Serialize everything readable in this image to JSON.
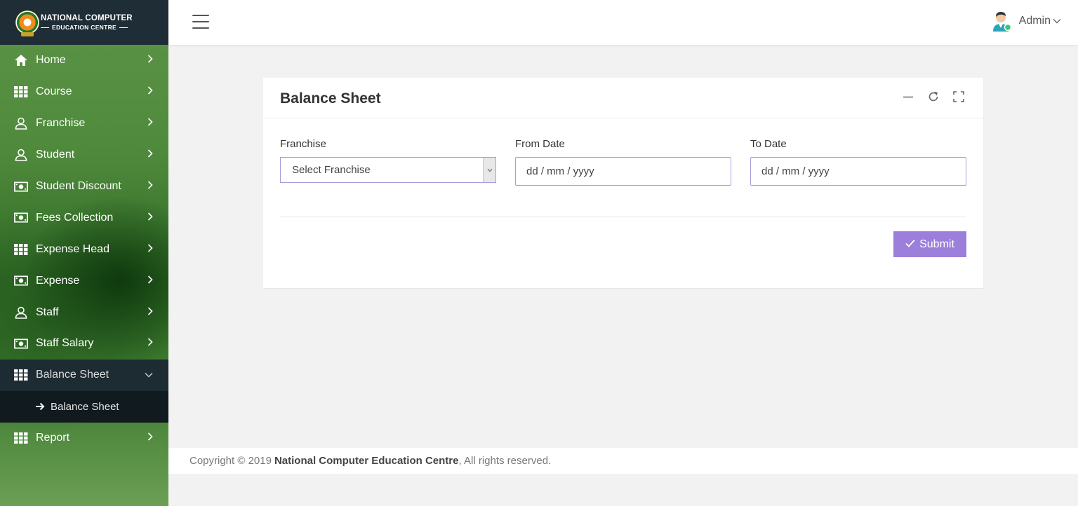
{
  "brand": {
    "line1": "NATIONAL COMPUTER",
    "line2": "EDUCATION CENTRE"
  },
  "sidebar": {
    "items": [
      {
        "label": "Home",
        "icon": "home-icon"
      },
      {
        "label": "Course",
        "icon": "grid-icon"
      },
      {
        "label": "Franchise",
        "icon": "user-icon"
      },
      {
        "label": "Student",
        "icon": "user-icon"
      },
      {
        "label": "Student Discount",
        "icon": "money-icon"
      },
      {
        "label": "Fees Collection",
        "icon": "money-icon"
      },
      {
        "label": "Expense Head",
        "icon": "grid-icon"
      },
      {
        "label": "Expense",
        "icon": "money-icon"
      },
      {
        "label": "Staff",
        "icon": "user-icon"
      },
      {
        "label": "Staff Salary",
        "icon": "money-icon"
      },
      {
        "label": "Balance Sheet",
        "icon": "grid-icon",
        "expanded": true
      },
      {
        "label": "Report",
        "icon": "grid-icon"
      }
    ],
    "submenu": {
      "label": "Balance Sheet",
      "icon": "arrow-right-icon"
    }
  },
  "topbar": {
    "user_name": "Admin"
  },
  "card": {
    "title": "Balance Sheet",
    "franchise_label": "Franchise",
    "franchise_value": "Select Franchise",
    "from_date_label": "From Date",
    "from_date_value": "dd / mm / yyyy",
    "to_date_label": "To Date",
    "to_date_value": "dd / mm / yyyy",
    "submit_label": "Submit"
  },
  "footer": {
    "prefix": "Copyright © 2019",
    "org": "National Computer Education Centre",
    "suffix": ", All rights reserved."
  },
  "colors": {
    "accent": "#9c7fdb",
    "sidebar_dark": "#1d2b33",
    "submenu_dark": "#111a1f",
    "logo_bar": "#1f2d36"
  }
}
